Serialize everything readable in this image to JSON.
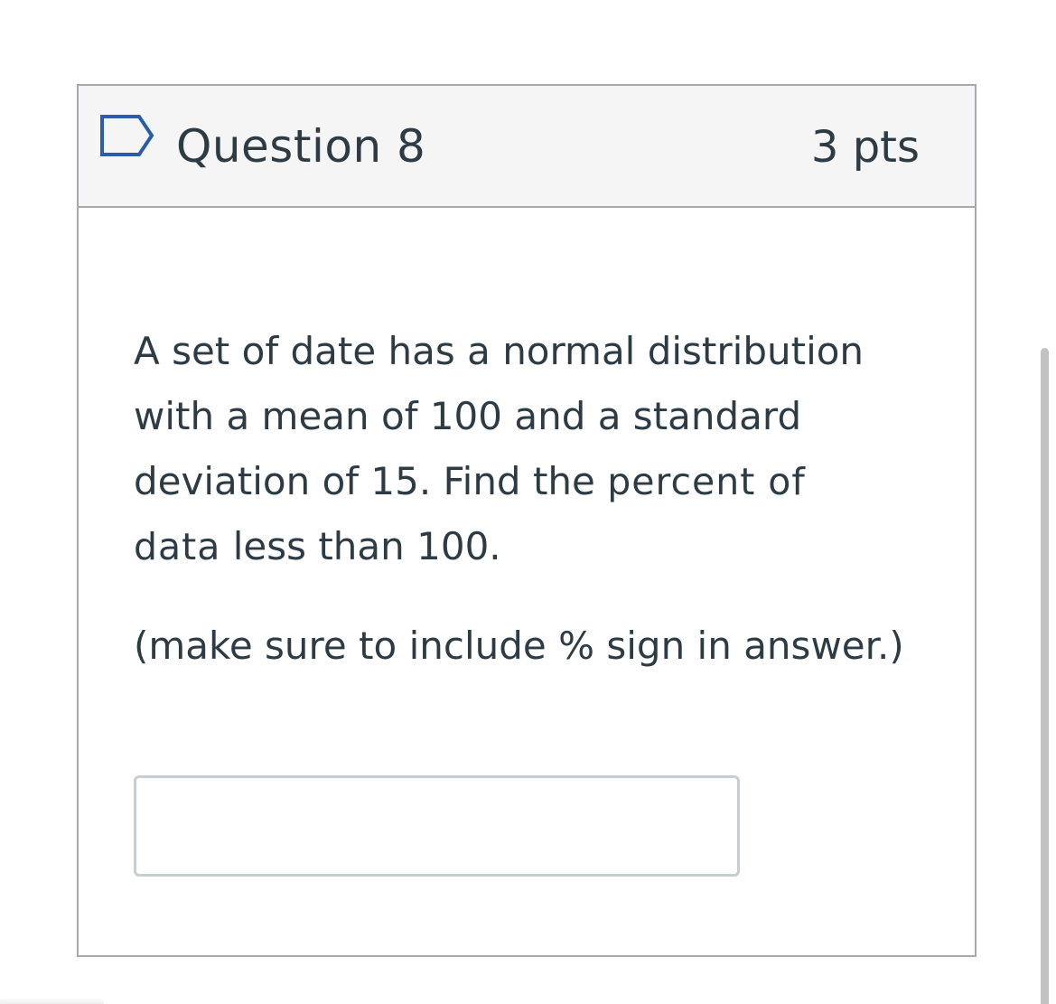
{
  "question": {
    "title": "Question 8",
    "points": "3 pts",
    "flag_icon": "flag-icon",
    "text_part1": "A set of date has a normal distribution with a mean of 100 and a standard deviation of 15.  Find the ",
    "text_emphasis": "percent of data",
    "text_part2": " less than 100.",
    "note": "(make sure to include % sign in answer.)",
    "answer_value": "",
    "answer_placeholder": ""
  },
  "colors": {
    "text": "#2d3b45",
    "header_bg": "#f5f5f5",
    "border": "#a6a9ad",
    "flag_stroke": "#2a5da8",
    "input_border": "#c7cdd1"
  }
}
